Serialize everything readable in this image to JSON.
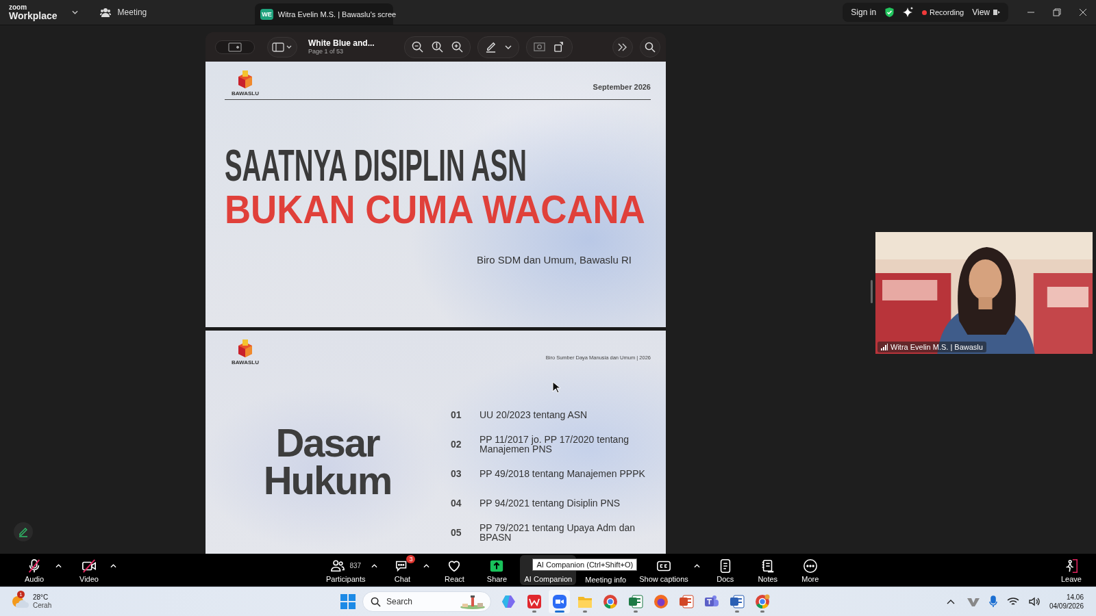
{
  "top_bar": {
    "logo_small": "zoom",
    "logo_large": "Workplace",
    "meeting_label": "Meeting",
    "share_tab": {
      "badge": "WE",
      "title": "Witra Evelin M.S. | Bawaslu's scree"
    },
    "sign_in": "Sign in",
    "recording": "Recording",
    "view": "View"
  },
  "viewer": {
    "title": "White Blue and...",
    "page": "Page 1 of 53"
  },
  "slide_1": {
    "logo_text": "BAWASLU",
    "date": "September 2026",
    "heading_line_1": "SAATNYA DISIPLIN ASN",
    "heading_line_2": "BUKAN CUMA WACANA",
    "subtitle": "Biro SDM dan Umum, Bawaslu RI"
  },
  "slide_2": {
    "logo_text": "BAWASLU",
    "header": "Biro Sumber Daya Manusia dan Umum | 2026",
    "title_line_1": "Dasar",
    "title_line_2": "Hukum",
    "items": [
      {
        "number": "01",
        "text": "UU 20/2023 tentang ASN"
      },
      {
        "number": "02",
        "text": "PP 11/2017 jo. PP 17/2020 tentang Manajemen PNS"
      },
      {
        "number": "03",
        "text": "PP 49/2018 tentang Manajemen PPPK"
      },
      {
        "number": "04",
        "text": "PP 94/2021 tentang Disiplin PNS"
      },
      {
        "number": "05",
        "text": "PP 79/2021 tentang Upaya Adm dan BPASN"
      }
    ]
  },
  "video_tile": {
    "name": "Witra Evelin M.S. | Bawaslu"
  },
  "toolbar": {
    "tooltip": "AI Companion (Ctrl+Shift+O)",
    "items": [
      {
        "kind": "audio",
        "label": "Audio",
        "off": true,
        "caret": true,
        "hovered": false
      },
      {
        "kind": "video",
        "label": "Video",
        "off": true,
        "caret": true,
        "hovered": false
      },
      {
        "kind": "participants",
        "label": "Participants",
        "count": "837",
        "caret": true,
        "hovered": false
      },
      {
        "kind": "chat",
        "label": "Chat",
        "badge": "3",
        "caret": true,
        "hovered": false
      },
      {
        "kind": "react",
        "label": "React",
        "hovered": false
      },
      {
        "kind": "share",
        "label": "Share",
        "hovered": false
      },
      {
        "kind": "ai-companion",
        "label": "AI Companion",
        "hovered": true
      },
      {
        "kind": "meeting-info",
        "label": "Meeting info",
        "hovered": false
      },
      {
        "kind": "captions",
        "label": "Show captions",
        "caret": true,
        "hovered": false
      },
      {
        "kind": "docs",
        "label": "Docs",
        "hovered": false
      },
      {
        "kind": "notes",
        "label": "Notes",
        "hovered": false
      },
      {
        "kind": "more",
        "label": "More",
        "hovered": false
      },
      {
        "kind": "leave",
        "label": "Leave",
        "hovered": false
      }
    ]
  },
  "taskbar": {
    "weather": {
      "badge": "1",
      "temperature": "28°C",
      "condition": "Cerah"
    },
    "search_placeholder": "Search",
    "apps": [
      {
        "kind": "copilot",
        "running": false,
        "active": false
      },
      {
        "kind": "wps",
        "running": true,
        "active": false
      },
      {
        "kind": "zoom",
        "running": true,
        "active": true
      },
      {
        "kind": "files",
        "running": true,
        "active": false
      },
      {
        "kind": "chrome",
        "running": false,
        "active": false
      },
      {
        "kind": "excel",
        "running": true,
        "active": false
      },
      {
        "kind": "firefox",
        "running": false,
        "active": false
      },
      {
        "kind": "powerpoint",
        "running": false,
        "active": false
      },
      {
        "kind": "teams",
        "running": false,
        "active": false
      },
      {
        "kind": "word",
        "running": true,
        "active": false
      },
      {
        "kind": "chrome-profile",
        "running": true,
        "active": false
      }
    ],
    "time": "14.06",
    "date": "04/09/2026"
  }
}
